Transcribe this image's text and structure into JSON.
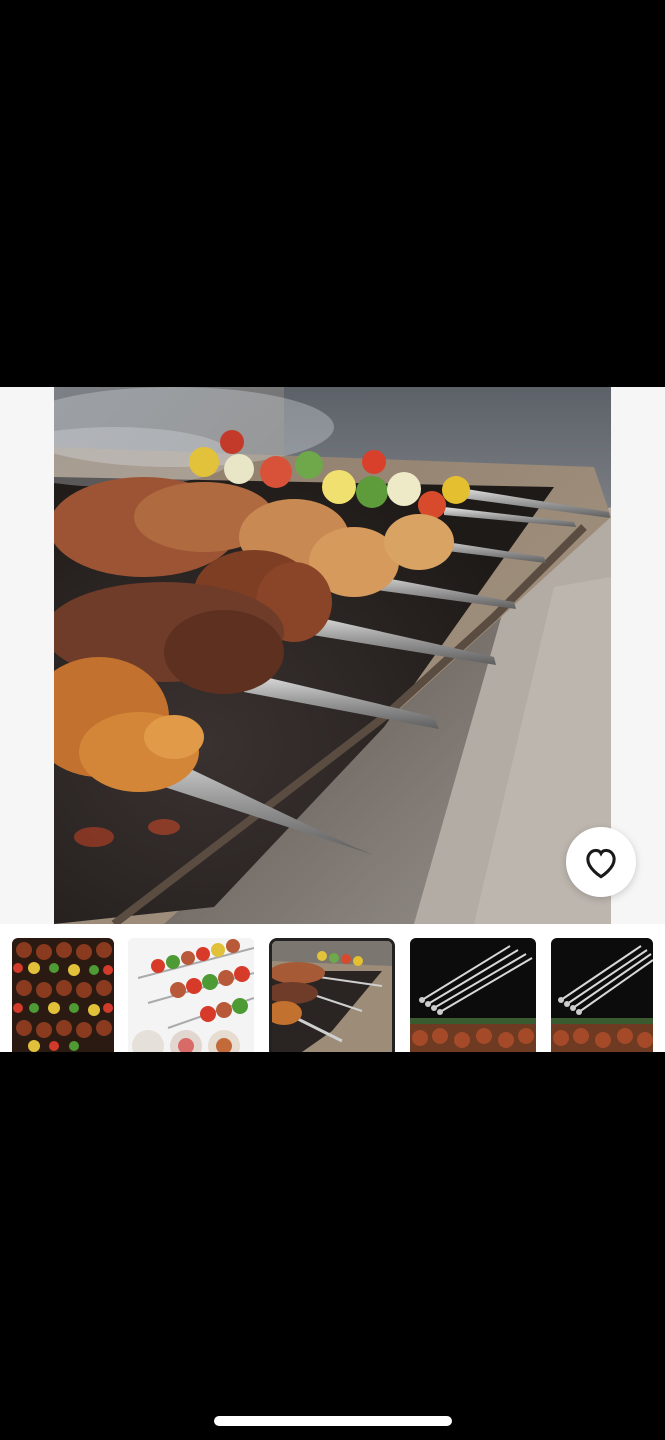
{
  "viewer": {
    "main_image": "bbq-skewers-on-grill-photo",
    "favorite_icon": "heart-outline-icon"
  },
  "thumbnails": [
    {
      "image": "colorful-kebab-skewers-photo",
      "selected": false
    },
    {
      "image": "vegetable-meat-skewers-white-background-photo",
      "selected": false
    },
    {
      "image": "bbq-skewers-on-grill-photo",
      "selected": true
    },
    {
      "image": "black-metal-skewers-set-photo",
      "selected": false
    },
    {
      "image": "black-metal-skewers-set-photo",
      "selected": false
    }
  ],
  "colors": {
    "screen_background": "#000000",
    "viewer_background": "#f6f6f6",
    "selected_border": "#222222",
    "home_indicator": "#ffffff"
  }
}
